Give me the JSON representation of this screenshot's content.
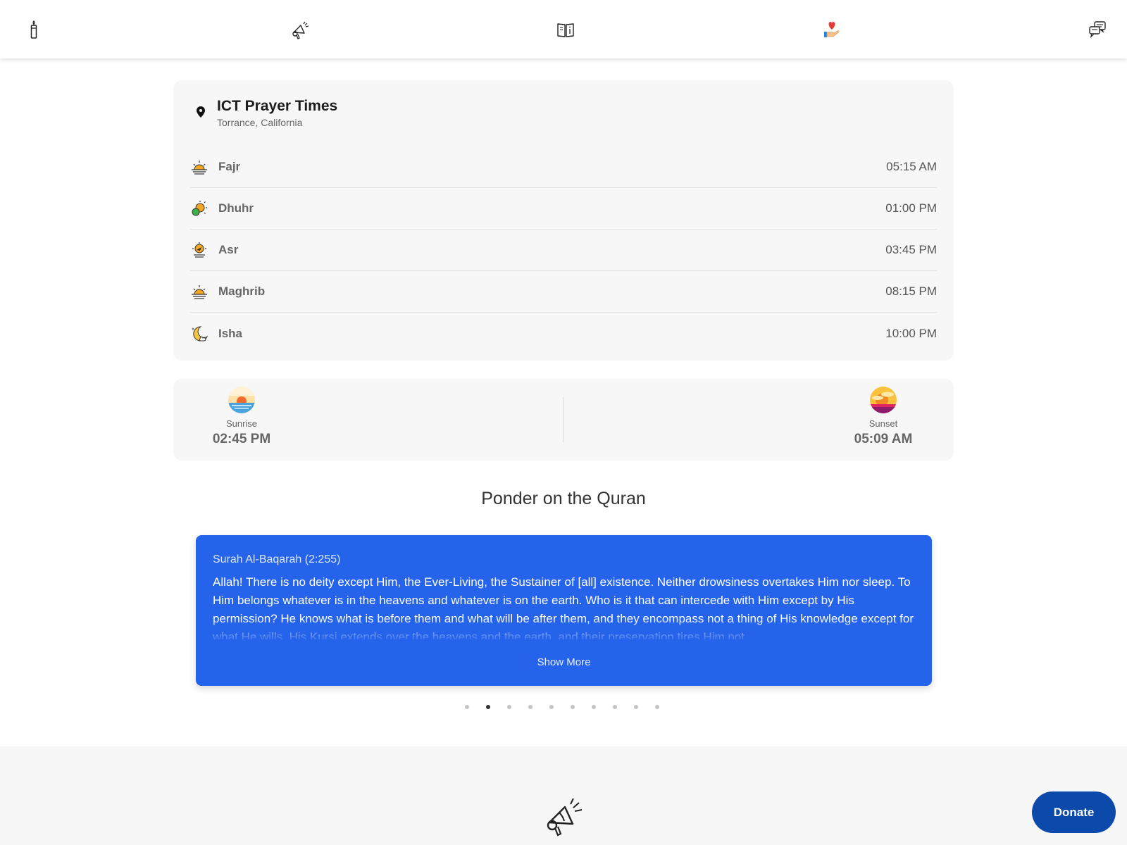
{
  "nav": {
    "items": [
      {
        "icon": "candle-icon"
      },
      {
        "icon": "megaphone-icon"
      },
      {
        "icon": "book-icon"
      },
      {
        "icon": "charity-heart-icon"
      },
      {
        "icon": "chat-bubbles-icon"
      }
    ]
  },
  "prayer_card": {
    "title": "ICT Prayer Times",
    "location": "Torrance, California",
    "prayers": [
      {
        "name": "Fajr",
        "time": "05:15 AM"
      },
      {
        "name": "Dhuhr",
        "time": "01:00 PM"
      },
      {
        "name": "Asr",
        "time": "03:45 PM"
      },
      {
        "name": "Maghrib",
        "time": "08:15 PM"
      },
      {
        "name": "Isha",
        "time": "10:00 PM"
      }
    ]
  },
  "sun": {
    "sunrise_label": "Sunrise",
    "sunrise_time": "02:45 PM",
    "sunset_label": "Sunset",
    "sunset_time": "05:09 AM"
  },
  "quran": {
    "section_title": "Ponder on the Quran",
    "reference": "Surah Al-Baqarah (2:255)",
    "text": "Allah! There is no deity except Him, the Ever-Living, the Sustainer of [all] existence. Neither drowsiness overtakes Him nor sleep. To Him belongs whatever is in the heavens and whatever is on the earth. Who is it that can intercede with Him except by His permission? He knows what is before them and what will be after them, and they encompass not a thing of His knowledge except for what He wills. His Kursi extends over the heavens and the earth, and their preservation tires Him not.",
    "show_more": "Show More",
    "slide_count": 10,
    "active_slide": 2
  },
  "donate_label": "Donate",
  "colors": {
    "verse_bg": "#2563eb",
    "donate_bg": "#0b4aaa",
    "card_bg": "#f7f7f7"
  }
}
